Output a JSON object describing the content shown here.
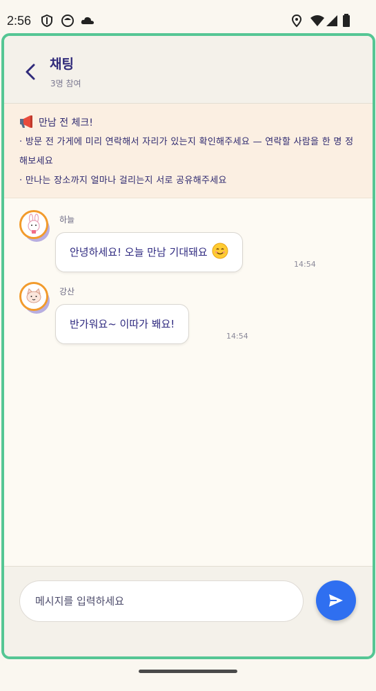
{
  "status_bar": {
    "time": "2:56",
    "left_icons": [
      "shield-icon",
      "face-icon",
      "cloud-icon"
    ],
    "right_icons": [
      "location-icon",
      "wifi-icon",
      "signal-icon",
      "battery-icon"
    ]
  },
  "header": {
    "back_icon": "chevron-left-icon",
    "title": "채팅",
    "subtitle": "3명 참여"
  },
  "notice": {
    "icon": "megaphone-icon",
    "title": "만남 전 체크!",
    "lines": [
      "· 방문 전 가게에 미리 연락해서 자리가 있는지 확인해주세요 — 연락할 사람을 한 명 정해보세요",
      "· 만나는 장소까지 얼마나 걸리는지 서로 공유해주세요"
    ]
  },
  "messages": [
    {
      "sender": "하늘",
      "avatar_icon": "bunny-avatar-icon",
      "text": "안녕하세요! 오늘 만남 기대돼요",
      "emoji": "smile-emoji-icon",
      "time": "14:54"
    },
    {
      "sender": "강산",
      "avatar_icon": "cat-avatar-icon",
      "text": "반가워요~ 이따가 봬요!",
      "time": "14:54"
    }
  ],
  "composer": {
    "placeholder": "메시지를 입력하세요",
    "value": "",
    "send_icon": "send-icon"
  },
  "colors": {
    "frame_border": "#55c694",
    "accent": "#2f6ff0",
    "notice_bg": "#fbefe2",
    "text": "#2f2a70",
    "avatar_ring": "#f29b2c"
  }
}
